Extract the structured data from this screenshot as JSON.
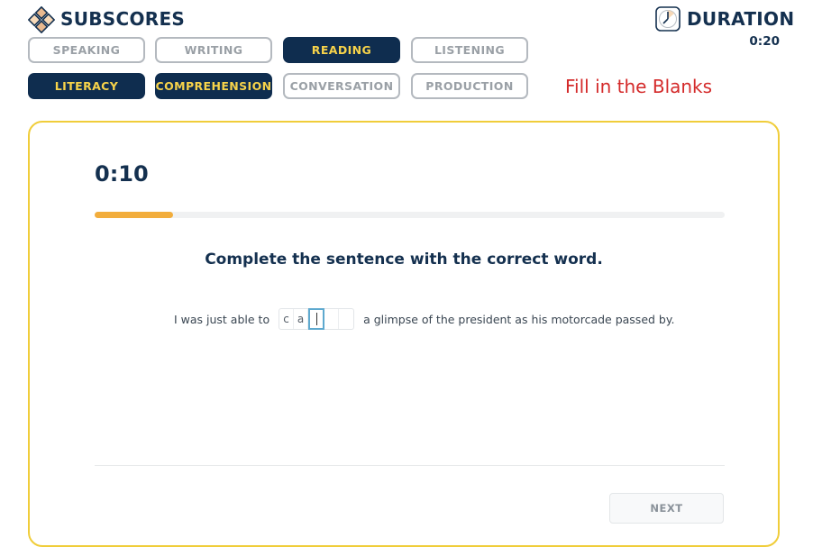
{
  "header": {
    "title": "SUBSCORES",
    "logo_icon": "diamond-grid-logo"
  },
  "subscores": {
    "row1": [
      {
        "label": "SPEAKING",
        "active": false
      },
      {
        "label": "WRITING",
        "active": false
      },
      {
        "label": "READING",
        "active": true
      },
      {
        "label": "LISTENING",
        "active": false
      }
    ],
    "row2": [
      {
        "label": "LITERACY",
        "active": true
      },
      {
        "label": "COMPREHENSION",
        "active": true
      },
      {
        "label": "CONVERSATION",
        "active": false
      },
      {
        "label": "PRODUCTION",
        "active": false
      }
    ]
  },
  "question_type": "Fill in the Blanks",
  "duration": {
    "title": "DURATION",
    "value": "0:20",
    "icon": "clock-icon"
  },
  "question": {
    "timer": "0:10",
    "progress_fraction": 0.125,
    "prompt": "Complete the sentence with the correct word.",
    "sentence_before": "I was just able to",
    "letters": [
      "c",
      "a",
      "",
      "",
      ""
    ],
    "sentence_after": "a glimpse of the president as his motorcade passed by."
  },
  "next_label": "NEXT",
  "colors": {
    "navy": "#0f2d4f",
    "accent_yellow": "#f7d34a",
    "progress_orange": "#f2ad3c",
    "card_border": "#f0cd3a",
    "label_red": "#d42a2a"
  }
}
